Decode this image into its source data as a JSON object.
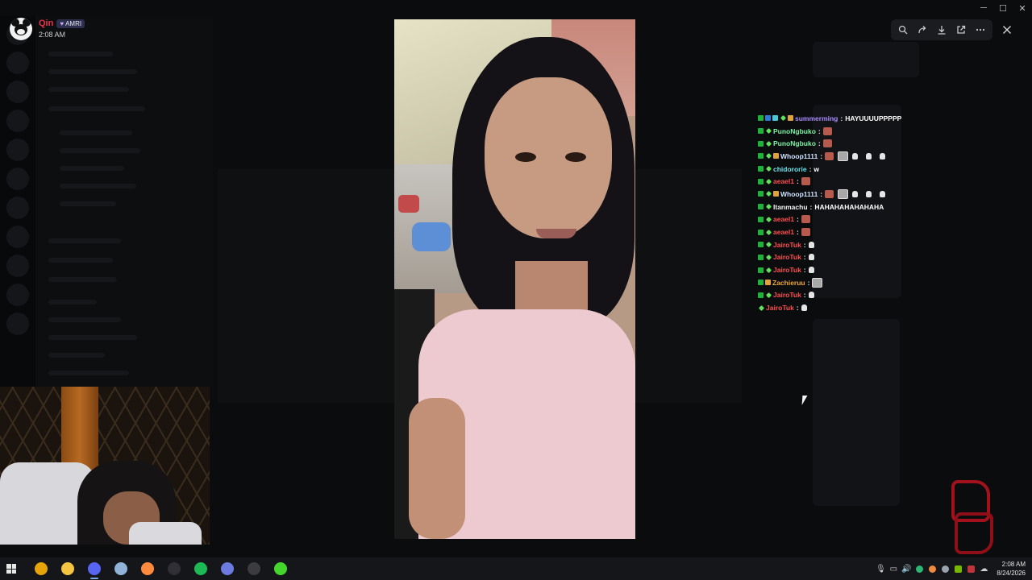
{
  "header": {
    "username": "Qin",
    "role": "AMRI",
    "time": "2:08 AM"
  },
  "viewer_toolbar": {
    "icons": [
      "zoom-icon",
      "forward-icon",
      "download-icon",
      "open-external-icon",
      "more-icon"
    ],
    "close_icon": "close-icon"
  },
  "chat": {
    "messages": [
      {
        "badges": [
          "mod",
          "blue",
          "cyan",
          "sub",
          "vip"
        ],
        "user": "summerming",
        "color": "#a98cff",
        "text": "HAYUUUUPPPPP",
        "emotes": []
      },
      {
        "badges": [
          "mod",
          "sub"
        ],
        "user": "PunoNgbuko",
        "color": "#7cf5a6",
        "text": "",
        "emotes": [
          "red"
        ]
      },
      {
        "badges": [
          "mod",
          "sub"
        ],
        "user": "PunoNgbuko",
        "color": "#7cf5a6",
        "text": "",
        "emotes": [
          "red"
        ]
      },
      {
        "badges": [
          "mod",
          "sub",
          "vip"
        ],
        "user": "Whoop1111",
        "color": "#cfe3ff",
        "text": "",
        "emotes": [
          "red",
          "gray",
          "hand",
          "hand",
          "hand"
        ]
      },
      {
        "badges": [
          "mod",
          "sub"
        ],
        "user": "chidororie",
        "color": "#69e0e8",
        "text": "w",
        "emotes": []
      },
      {
        "badges": [
          "mod",
          "sub"
        ],
        "user": "aeael1",
        "color": "#ff4f4f",
        "text": "",
        "emotes": [
          "red"
        ]
      },
      {
        "badges": [
          "mod",
          "sub",
          "vip"
        ],
        "user": "Whoop1111",
        "color": "#cfe3ff",
        "text": "",
        "emotes": [
          "red",
          "gray",
          "hand",
          "hand",
          "hand"
        ]
      },
      {
        "badges": [
          "mod",
          "sub"
        ],
        "user": "Itanmachu",
        "color": "#f2f2f2",
        "text": "HAHAHAHAHAHAHA",
        "emotes": []
      },
      {
        "badges": [
          "mod",
          "sub"
        ],
        "user": "aeael1",
        "color": "#ff4f4f",
        "text": "",
        "emotes": [
          "red"
        ]
      },
      {
        "badges": [
          "mod",
          "sub"
        ],
        "user": "aeael1",
        "color": "#ff4f4f",
        "text": "",
        "emotes": [
          "red"
        ]
      },
      {
        "badges": [
          "mod",
          "sub"
        ],
        "user": "JairoTuk",
        "color": "#ff4f4f",
        "text": "",
        "emotes": [
          "hand"
        ]
      },
      {
        "badges": [
          "mod",
          "sub"
        ],
        "user": "JairoTuk",
        "color": "#ff4f4f",
        "text": "",
        "emotes": [
          "hand"
        ]
      },
      {
        "badges": [
          "mod",
          "sub"
        ],
        "user": "JairoTuk",
        "color": "#ff4f4f",
        "text": "",
        "emotes": [
          "hand"
        ]
      },
      {
        "badges": [
          "mod",
          "vip"
        ],
        "user": "Zachieruu",
        "color": "#f0a73a",
        "text": "",
        "emotes": [
          "gray"
        ]
      },
      {
        "badges": [
          "mod",
          "sub"
        ],
        "user": "JairoTuk",
        "color": "#ff4f4f",
        "text": "",
        "emotes": [
          "hand"
        ]
      },
      {
        "badges": [
          "sub"
        ],
        "user": "JairoTuk",
        "color": "#ff4f4f",
        "text": "",
        "emotes": [
          "hand"
        ]
      }
    ]
  },
  "taskbar": {
    "apps": [
      {
        "name": "chrome",
        "color": "#e5a50a",
        "active": false
      },
      {
        "name": "file-explorer",
        "color": "#f5c542",
        "active": false
      },
      {
        "name": "discord",
        "color": "#5865f2",
        "active": true
      },
      {
        "name": "notepad",
        "color": "#8fb4d8",
        "active": false
      },
      {
        "name": "firefox",
        "color": "#ff8a3d",
        "active": false
      },
      {
        "name": "obs",
        "color": "#2f2f35",
        "active": false
      },
      {
        "name": "spotify",
        "color": "#1db954",
        "active": false
      },
      {
        "name": "settings",
        "color": "#6d7be0",
        "active": false
      },
      {
        "name": "mouse-app",
        "color": "#3b3b40",
        "active": false
      },
      {
        "name": "razer",
        "color": "#44d62c",
        "active": false
      }
    ],
    "clock_time": "2:08 AM",
    "clock_date": "8/24/2026"
  }
}
